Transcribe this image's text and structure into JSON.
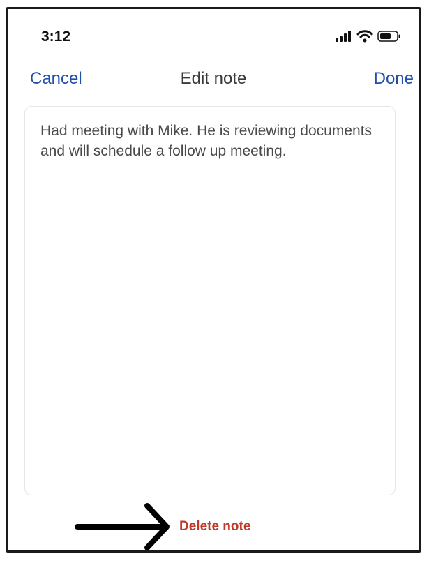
{
  "status_bar": {
    "time": "3:12",
    "icons": [
      "signal-icon",
      "wifi-icon",
      "battery-icon"
    ]
  },
  "nav": {
    "cancel_label": "Cancel",
    "title": "Edit note",
    "done_label": "Done"
  },
  "note": {
    "text": "Had meeting with Mike. He is reviewing documents and will schedule a follow up meeting."
  },
  "footer": {
    "delete_label": "Delete note"
  },
  "colors": {
    "accent": "#1f4fa8",
    "destructive": "#c0392b"
  }
}
